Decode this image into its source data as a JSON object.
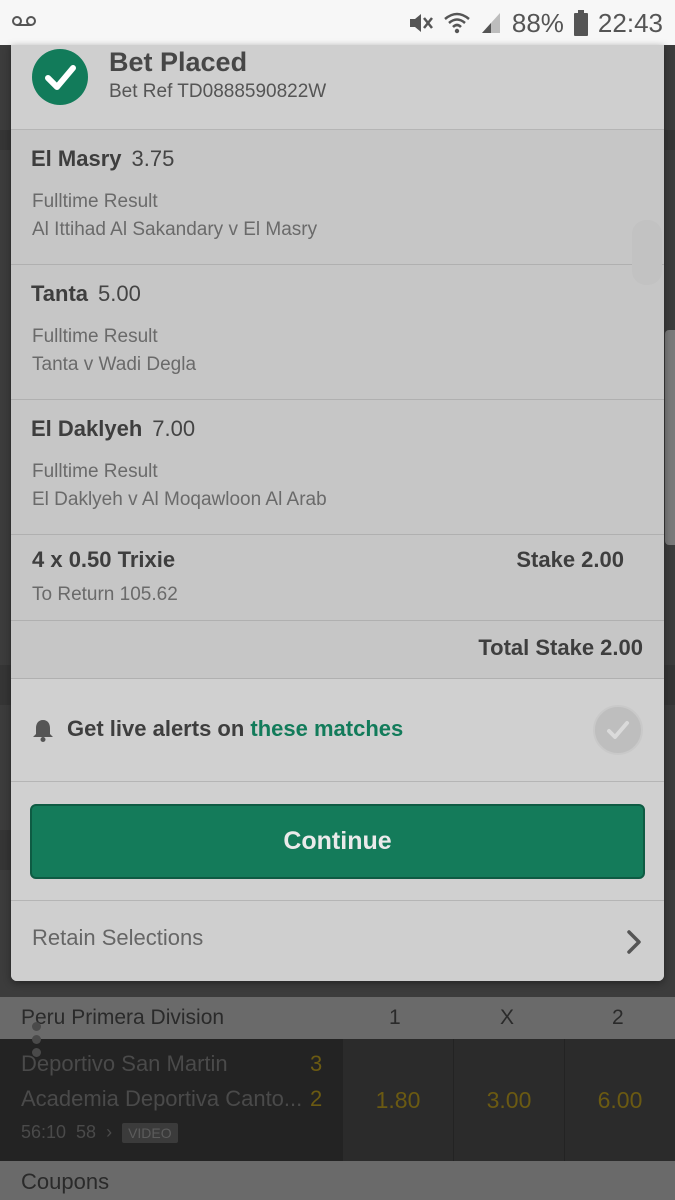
{
  "status_bar": {
    "battery": "88%",
    "time": "22:43",
    "icons": [
      "voicemail-icon",
      "mute-icon",
      "wifi-icon",
      "signal-icon",
      "battery-icon"
    ]
  },
  "bet_receipt": {
    "title": "Bet Placed",
    "bet_ref": "Bet Ref TD0888590822W",
    "selections": [
      {
        "selection": "El Masry",
        "odds": "3.75",
        "market": "Fulltime Result",
        "event": "Al Ittihad Al Sakandary v El Masry"
      },
      {
        "selection": "Tanta",
        "odds": "5.00",
        "market": "Fulltime Result",
        "event": "Tanta v Wadi Degla"
      },
      {
        "selection": "El Daklyeh",
        "odds": "7.00",
        "market": "Fulltime Result",
        "event": "El Daklyeh v Al Moqawloon Al Arab"
      }
    ],
    "bet_type": "4 x 0.50 Trixie",
    "stake": "Stake 2.00",
    "to_return": "To Return 105.62",
    "total_stake": "Total Stake 2.00",
    "alerts_prefix": "Get live alerts on ",
    "alerts_link": "these matches",
    "continue_label": "Continue",
    "retain_label": "Retain Selections"
  },
  "background": {
    "league": "Peru Primera Division",
    "col_1": "1",
    "col_x": "X",
    "col_2": "2",
    "team_home": "Deportivo San Martin",
    "team_away": "Academia Deportiva Canto...",
    "score_home": "3",
    "score_away": "2",
    "match_time": "56:10",
    "markets_count": "58",
    "video_badge": "VIDEO",
    "odds_1": "1.80",
    "odds_x": "3.00",
    "odds_2": "6.00",
    "coupons": "Coupons"
  },
  "colors": {
    "accent_green": "#127b5a",
    "odds_gold": "#6b5a12"
  }
}
